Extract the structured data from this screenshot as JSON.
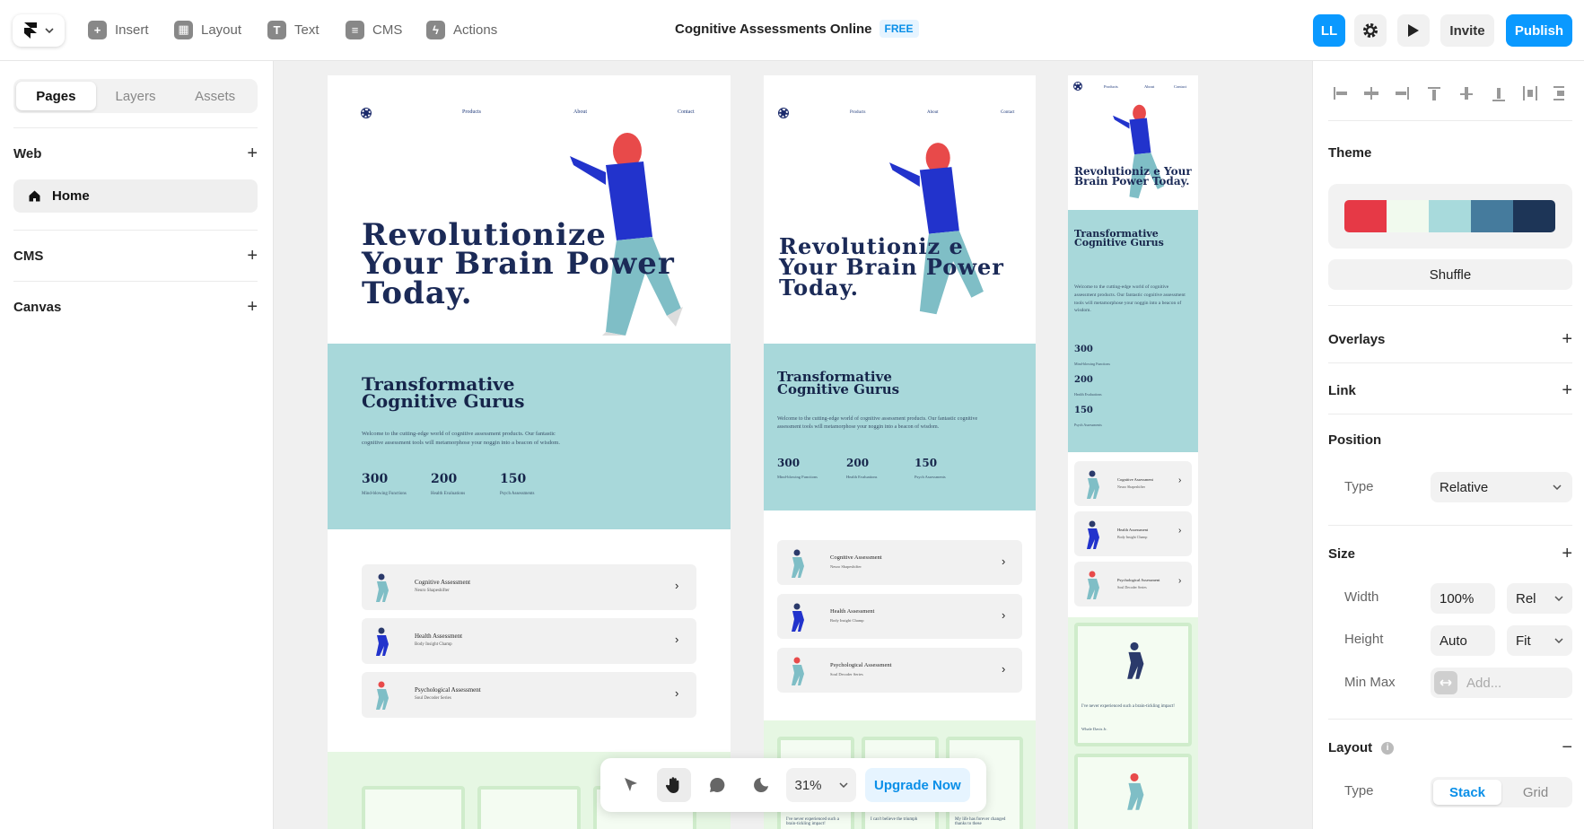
{
  "topbar": {
    "insert_label": "Insert",
    "layout_label": "Layout",
    "text_label": "Text",
    "cms_label": "CMS",
    "actions_label": "Actions",
    "project_title": "Cognitive Assessments Online",
    "plan_badge": "FREE",
    "avatar_initials": "LL",
    "invite_label": "Invite",
    "publish_label": "Publish"
  },
  "left_panel": {
    "tabs": [
      "Pages",
      "Layers",
      "Assets"
    ],
    "active_tab": "Pages",
    "sections": {
      "web": "Web",
      "cms": "CMS",
      "canvas": "Canvas"
    },
    "pages": [
      "Home"
    ]
  },
  "site": {
    "nav": [
      "Products",
      "About",
      "Contact"
    ],
    "hero_title": "Revolutionize Your Brain Power Today.",
    "hero_title_tablet": "Revolutioniz e Your Brain Power Today.",
    "hero_title_mobile": "Revolutioniz e Your Brain Power Today.",
    "section_title": "Transformative Cognitive Gurus",
    "section_text": "Welcome to the cutting-edge world of cognitive assessment products. Our fantastic cognitive assessment tools will metamorphose your noggin into a beacon of wisdom.",
    "stats": [
      {
        "value": "300",
        "label": "Mind-blowing Functions"
      },
      {
        "value": "200",
        "label": "Health Evaluations"
      },
      {
        "value": "150",
        "label": "Psych Assessments"
      }
    ],
    "cards": [
      {
        "title": "Cognitive Assessment",
        "subtitle": "Neuro Shapeshifter"
      },
      {
        "title": "Health Assessment",
        "subtitle": "Body Insight Champ"
      },
      {
        "title": "Psychological Assessment",
        "subtitle": "Soul Decoder Series"
      }
    ],
    "testimonials": [
      "I've never experienced such a brain-tickling impact!",
      "I can't believe the triumph",
      "My life has forever changed thanks to these"
    ],
    "testimonial_author": "Whale Davis Jr."
  },
  "canvas_toolbar": {
    "zoom": "31%",
    "upgrade_label": "Upgrade Now"
  },
  "right_panel": {
    "theme_label": "Theme",
    "theme_colors": [
      "#e63946",
      "#f1faee",
      "#a8dadc",
      "#457b9d",
      "#1d3557"
    ],
    "shuffle_label": "Shuffle",
    "overlays_label": "Overlays",
    "link_label": "Link",
    "position_label": "Position",
    "type_label": "Type",
    "position_type": "Relative",
    "size_label": "Size",
    "width_label": "Width",
    "width_value": "100%",
    "width_unit": "Rel",
    "height_label": "Height",
    "height_value": "Auto",
    "height_unit": "Fit",
    "minmax_label": "Min Max",
    "minmax_placeholder": "Add...",
    "layout_label": "Layout",
    "layout_type_label": "Type",
    "layout_stack": "Stack",
    "layout_grid": "Grid"
  }
}
